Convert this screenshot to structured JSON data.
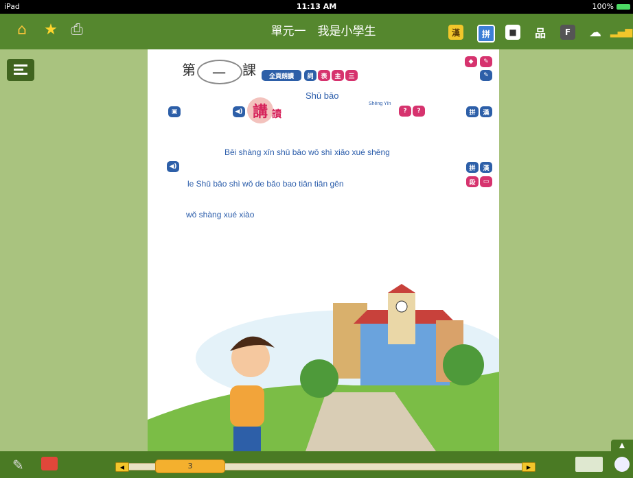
{
  "status_bar": {
    "device": "iPad",
    "time": "11:13 AM",
    "battery": "100%"
  },
  "toolbar": {
    "title": "單元一　我是小學生",
    "left_icons": [
      "home-icon",
      "star-icon",
      "print-icon"
    ],
    "right_badges": [
      {
        "label": "漢",
        "name": "hanzi-mode-button"
      },
      {
        "label": "拼",
        "name": "pinyin-mode-button"
      },
      {
        "label": "",
        "name": "speaker-tool-button"
      },
      {
        "label": "",
        "name": "sitemap-button"
      },
      {
        "label": "F",
        "name": "flash-button"
      },
      {
        "label": "",
        "name": "cloud-button"
      },
      {
        "label": "",
        "name": "signal-button"
      }
    ]
  },
  "page": {
    "lesson": {
      "prefix": "第",
      "number": "一",
      "suffix": "課"
    },
    "title_pinyin": "Shū bāo",
    "heading_big": "講",
    "heading_small": "讀",
    "shengyin_pinyin": "Shēng Yīn",
    "lines": [
      "Bēi shàng xīn  shū  bāo        wǒ   shì   xiǎo  xué  shēng",
      "le          Shū  bāo  shì   wǒ   de   bǎo  bao          tiān  tiān  gēn",
      "wǒ  shàng xué  xiào"
    ],
    "top_buttons": [
      "全頁朗讀",
      "詞",
      "表",
      "主",
      "三"
    ],
    "question_buttons": [
      "?",
      "?"
    ],
    "side_buttons": [
      "拼",
      "漢",
      "拼",
      "漢",
      "段"
    ]
  },
  "bottom": {
    "page_number": "3"
  },
  "colors": {
    "toolbar": "#55872e",
    "background": "#a9c37f",
    "pinyin": "#2a5caa",
    "accent_pink": "#d6336e",
    "slider_thumb": "#f4b02e"
  }
}
